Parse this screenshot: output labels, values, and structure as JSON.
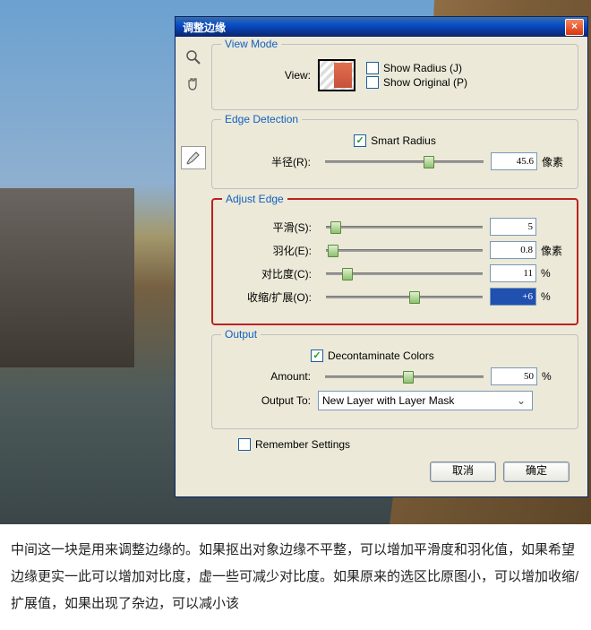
{
  "dialog": {
    "title": "调整边缘",
    "viewMode": {
      "legend": "View Mode",
      "viewLabel": "View:",
      "showRadius": "Show Radius (J)",
      "showOriginal": "Show Original (P)"
    },
    "edgeDetection": {
      "legend": "Edge Detection",
      "smartRadius": "Smart Radius",
      "radiusLabel": "半径(R):",
      "radiusValue": "45.6",
      "radiusUnit": "像素"
    },
    "adjustEdge": {
      "legend": "Adjust Edge",
      "smoothLabel": "平滑(S):",
      "smoothValue": "5",
      "featherLabel": "羽化(E):",
      "featherValue": "0.8",
      "featherUnit": "像素",
      "contrastLabel": "对比度(C):",
      "contrastValue": "11",
      "contrastUnit": "%",
      "shiftLabel": "收缩/扩展(O):",
      "shiftValue": "+6",
      "shiftUnit": "%"
    },
    "output": {
      "legend": "Output",
      "decontaminate": "Decontaminate Colors",
      "amountLabel": "Amount:",
      "amountValue": "50",
      "amountUnit": "%",
      "outputToLabel": "Output To:",
      "outputToValue": "New Layer with Layer Mask"
    },
    "remember": "Remember Settings",
    "cancel": "取消",
    "ok": "确定"
  },
  "description": "中间这一块是用来调整边缘的。如果抠出对象边缘不平整，可以增加平滑度和羽化值，如果希望边缘更实一此可以增加对比度，虚一些可减少对比度。如果原来的选区比原图小，可以增加收缩/扩展值，如果出现了杂边，可以减小该"
}
